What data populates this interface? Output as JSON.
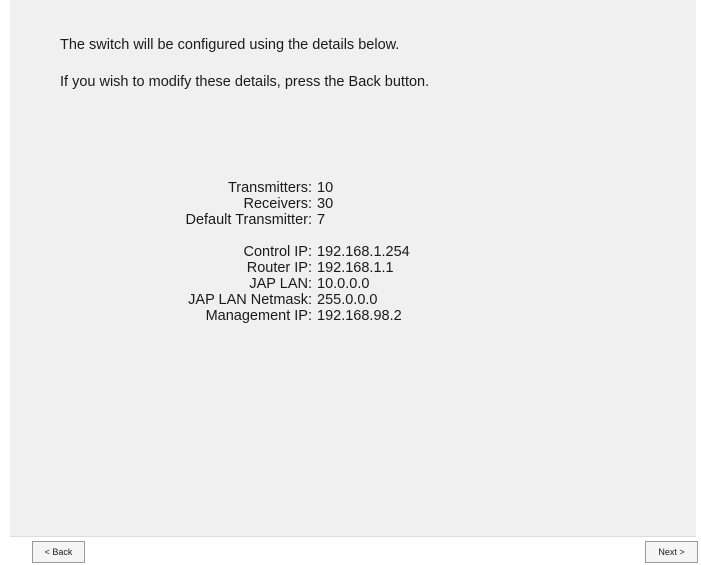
{
  "intro": {
    "line1": "The switch will be configured using the details below.",
    "line2": "If you wish to modify these details, press the Back button."
  },
  "details": {
    "group1": [
      {
        "label": "Transmitters:",
        "value": "10"
      },
      {
        "label": "Receivers:",
        "value": "30"
      },
      {
        "label": "Default Transmitter:",
        "value": "7"
      }
    ],
    "group2": [
      {
        "label": "Control IP:",
        "value": "192.168.1.254"
      },
      {
        "label": "Router IP:",
        "value": "192.168.1.1"
      },
      {
        "label": "JAP LAN:",
        "value": "10.0.0.0"
      },
      {
        "label": "JAP LAN Netmask:",
        "value": "255.0.0.0"
      },
      {
        "label": "Management IP:",
        "value": "192.168.98.2"
      }
    ]
  },
  "buttons": {
    "back": "< Back",
    "next": "Next >"
  }
}
